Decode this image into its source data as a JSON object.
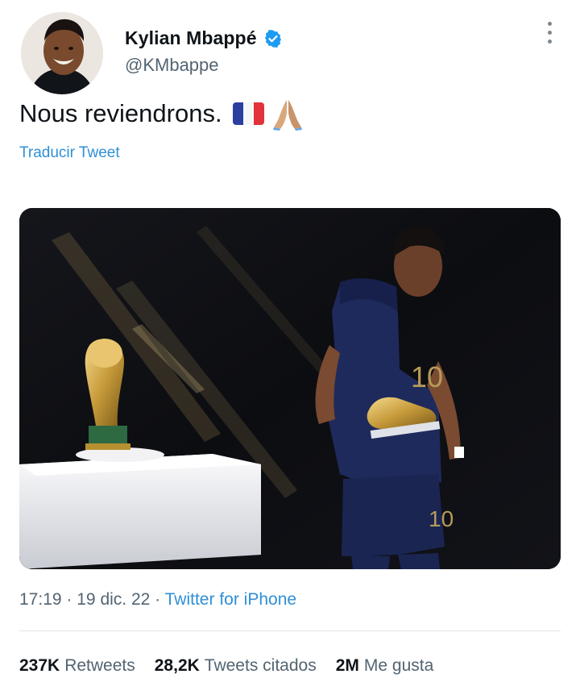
{
  "author": {
    "display_name": "Kylian Mbappé",
    "handle": "@KMbappe",
    "verified": true,
    "avatar_icon": "profile-photo"
  },
  "tweet": {
    "text": "Nous reviendrons.",
    "emojis": [
      "france-flag",
      "folded-hands-medium-light-skin"
    ],
    "translate_label": "Traducir Tweet",
    "media": {
      "type": "photo",
      "subject": "player with golden boot beside trophy"
    }
  },
  "meta": {
    "time": "17:19",
    "date": "19 dic. 22",
    "separator": "·",
    "source": "Twitter for iPhone"
  },
  "stats": [
    {
      "count": "237K",
      "label": "Retweets"
    },
    {
      "count": "28,2K",
      "label": "Tweets citados"
    },
    {
      "count": "2M",
      "label": "Me gusta"
    }
  ],
  "colors": {
    "link": "#2f8fd6",
    "verified": "#1d9bf0",
    "muted": "#536471",
    "jersey": "#1f2a5c"
  }
}
